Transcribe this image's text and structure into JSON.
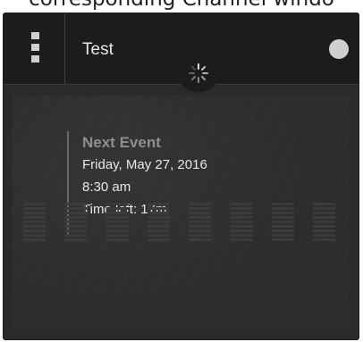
{
  "page_caption": "corresponding Channel windo",
  "channel": {
    "title": "Test",
    "menu_icon": "vertical-dots-icon",
    "status_icon": "status-dot-icon",
    "status_color": "#cfcfcf",
    "loading_icon": "loading-spinner-icon"
  },
  "next_event": {
    "heading": "Next Event",
    "date": "Friday, May 27, 2016",
    "time": "8:30 am",
    "time_left": "Time left: 17m"
  },
  "meters": {
    "count": 8,
    "level": 0,
    "icon": "audio-level-meter-icon"
  },
  "colors": {
    "card_background": "#2a2a2a",
    "header_background": "#1c1c1c",
    "text": "#e8e8e8",
    "heading": "#8f8f8f"
  }
}
